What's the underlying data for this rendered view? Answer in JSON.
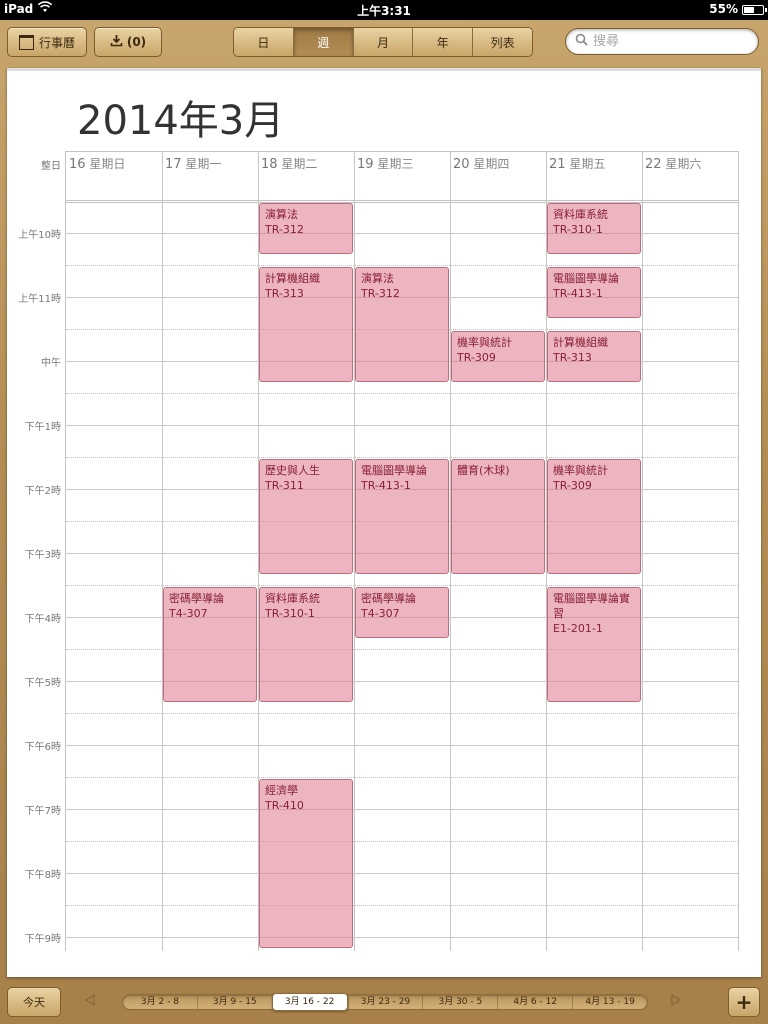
{
  "status_bar": {
    "carrier": "iPad",
    "time": "上午3:31",
    "battery_percent": "55%",
    "battery_level": 0.55
  },
  "toolbar": {
    "calendars_label": "行事曆",
    "inbox_label": "(0)",
    "view_segments": [
      "日",
      "週",
      "月",
      "年",
      "列表"
    ],
    "active_segment": "週",
    "search_placeholder": "搜尋"
  },
  "calendar": {
    "month_title": "2014年3月",
    "all_day_label": "整日",
    "days": [
      {
        "num": "16",
        "name": "星期日"
      },
      {
        "num": "17",
        "name": "星期一"
      },
      {
        "num": "18",
        "name": "星期二"
      },
      {
        "num": "19",
        "name": "星期三"
      },
      {
        "num": "20",
        "name": "星期四"
      },
      {
        "num": "21",
        "name": "星期五"
      },
      {
        "num": "22",
        "name": "星期六"
      }
    ],
    "time_labels": [
      "上午10時",
      "上午11時",
      "中午",
      "下午1時",
      "下午2時",
      "下午3時",
      "下午4時",
      "下午5時",
      "下午6時",
      "下午7時",
      "下午8時",
      "下午9時"
    ],
    "events": [
      {
        "day": 2,
        "start": 9.5,
        "end": 10.33,
        "title": "演算法",
        "room": "TR-312"
      },
      {
        "day": 5,
        "start": 9.5,
        "end": 10.33,
        "title": "資料庫系統",
        "room": "TR-310-1"
      },
      {
        "day": 2,
        "start": 10.5,
        "end": 12.33,
        "title": "計算機組織",
        "room": "TR-313"
      },
      {
        "day": 3,
        "start": 10.5,
        "end": 12.33,
        "title": "演算法",
        "room": "TR-312"
      },
      {
        "day": 5,
        "start": 10.5,
        "end": 11.33,
        "title": "電腦圖學導論",
        "room": "TR-413-1"
      },
      {
        "day": 4,
        "start": 11.5,
        "end": 12.33,
        "title": "機率與統計",
        "room": "TR-309"
      },
      {
        "day": 5,
        "start": 11.5,
        "end": 12.33,
        "title": "計算機組織",
        "room": "TR-313"
      },
      {
        "day": 2,
        "start": 13.5,
        "end": 15.33,
        "title": "歷史與人生",
        "room": "TR-311"
      },
      {
        "day": 3,
        "start": 13.5,
        "end": 15.33,
        "title": "電腦圖學導論",
        "room": "TR-413-1"
      },
      {
        "day": 4,
        "start": 13.5,
        "end": 15.33,
        "title": "體育(木球)",
        "room": ""
      },
      {
        "day": 5,
        "start": 13.5,
        "end": 15.33,
        "title": "機率與統計",
        "room": "TR-309"
      },
      {
        "day": 1,
        "start": 15.5,
        "end": 17.33,
        "title": "密碼學導論",
        "room": "T4-307"
      },
      {
        "day": 2,
        "start": 15.5,
        "end": 17.33,
        "title": "資料庫系統",
        "room": "TR-310-1"
      },
      {
        "day": 3,
        "start": 15.5,
        "end": 16.33,
        "title": "密碼學導論",
        "room": "T4-307"
      },
      {
        "day": 5,
        "start": 15.5,
        "end": 17.33,
        "title": "電腦圖學導論實習",
        "room": "E1-201-1"
      },
      {
        "day": 2,
        "start": 18.5,
        "end": 21.2,
        "title": "經濟學",
        "room": "TR-410"
      }
    ]
  },
  "bottom_bar": {
    "today_label": "今天",
    "add_label": "+",
    "weeks": [
      "3月 2 - 8",
      "3月 9 - 15",
      "3月 16 - 22",
      "3月 23 - 29",
      "3月 30 - 5",
      "4月 6 - 12",
      "4月 13 - 19"
    ],
    "active_week_index": 2
  }
}
